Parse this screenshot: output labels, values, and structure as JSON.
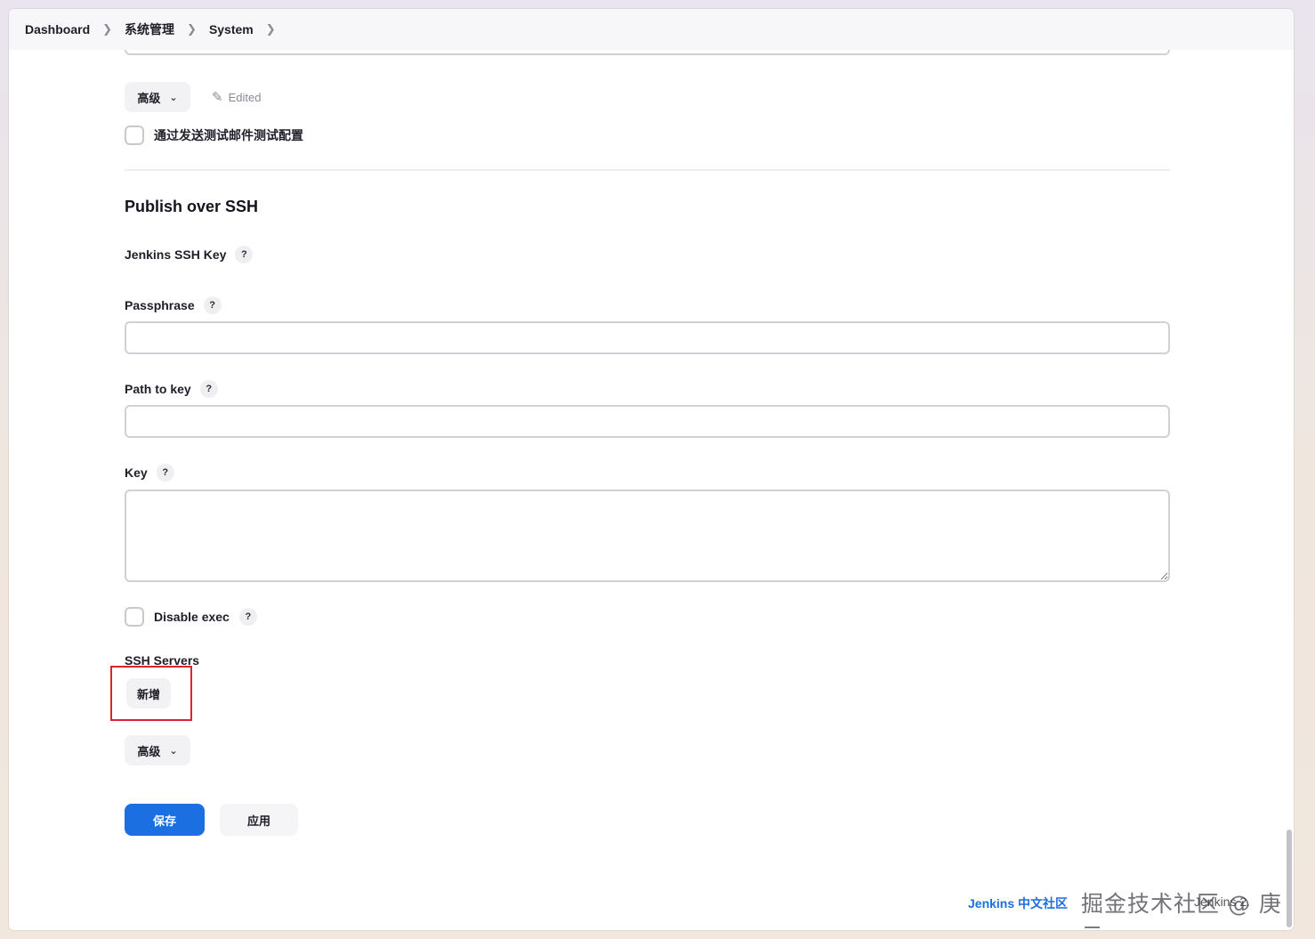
{
  "breadcrumb": {
    "items": [
      "Dashboard",
      "系统管理",
      "System"
    ]
  },
  "email_section": {
    "advanced_label": "高级",
    "edited_label": "Edited",
    "test_mail_label": "通过发送测试邮件测试配置"
  },
  "ssh_section": {
    "title": "Publish over SSH",
    "jenkins_ssh_key_label": "Jenkins SSH Key",
    "passphrase_label": "Passphrase",
    "passphrase_value": "",
    "path_to_key_label": "Path to key",
    "path_to_key_value": "",
    "key_label": "Key",
    "key_value": "",
    "disable_exec_label": "Disable exec",
    "ssh_servers_label": "SSH Servers",
    "add_label": "新增",
    "advanced_label": "高级",
    "help_glyph": "?"
  },
  "actions": {
    "save_label": "保存",
    "apply_label": "应用"
  },
  "footer": {
    "community_link": "Jenkins 中文社区",
    "version": "Jenkins 2.",
    "watermark": "掘金技术社区 @ 庚云"
  },
  "colors": {
    "primary": "#1c6fe0",
    "highlight_border": "#d9262b"
  }
}
